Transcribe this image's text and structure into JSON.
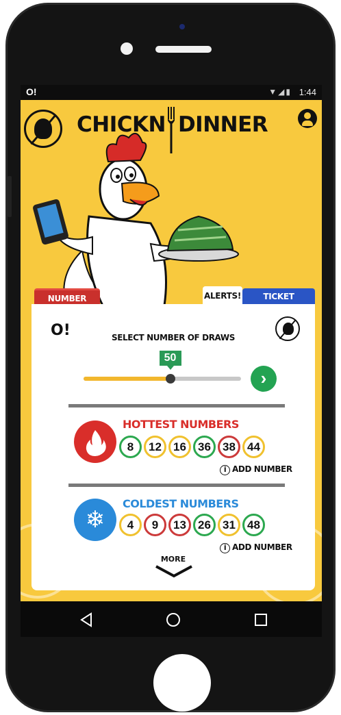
{
  "statusbar": {
    "app_icon": "O!",
    "signal_icons": "wifi-signal-battery",
    "time": "1:44"
  },
  "header": {
    "title_left": "CHICKN",
    "title_right": "DINNER",
    "logo_icon": "chicken-logo-icon",
    "profile_icon": "user-profile-icon"
  },
  "tabs": {
    "number_picker": "NUMBER PICKER",
    "alerts": "ALERTS!",
    "ticket_manager": "TICKET MANAGER"
  },
  "card": {
    "logo_text": "O!",
    "draws_label": "SELECT NUMBER OF DRAWS",
    "slider": {
      "value": "50",
      "fraction": 0.55
    },
    "go_icon": "chevron-right-icon",
    "hot": {
      "title": "HOTTEST NUMBERS",
      "icon": "flame-icon",
      "numbers": [
        "8",
        "12",
        "16",
        "36",
        "38",
        "44"
      ],
      "ring_colors": [
        "c1",
        "c2",
        "c2",
        "c1",
        "c3",
        "c2"
      ],
      "add_label": "ADD NUMBER"
    },
    "cold": {
      "title": "COLDEST NUMBERS",
      "icon": "snowflake-icon",
      "numbers": [
        "4",
        "9",
        "13",
        "26",
        "31",
        "48"
      ],
      "ring_colors": [
        "c2",
        "c3",
        "c3",
        "c1",
        "c2",
        "c1"
      ],
      "add_label": "ADD NUMBER"
    },
    "more_label": "MORE"
  },
  "colors": {
    "background": "#f8c93e",
    "hot": "#d92e2a",
    "cold": "#2a8ad9",
    "green": "#23a352",
    "tab_red": "#c9302c",
    "tab_blue": "#2a55c5"
  }
}
